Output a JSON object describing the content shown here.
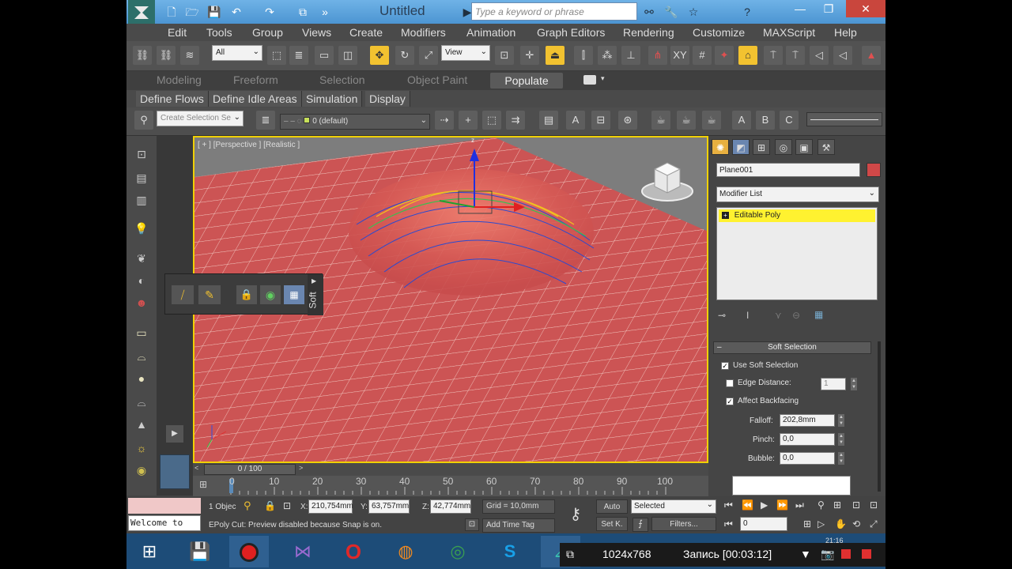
{
  "window": {
    "title": "Untitled",
    "search_placeholder": "Type a keyword or phrase"
  },
  "menu": [
    "Edit",
    "Tools",
    "Group",
    "Views",
    "Create",
    "Modifiers",
    "Animation",
    "Graph Editors",
    "Rendering",
    "Customize",
    "MAXScript",
    "Help"
  ],
  "toolbar": {
    "selection_filter": "All",
    "ref_coord": "View"
  },
  "ribbon": {
    "tabs": [
      "Modeling",
      "Freeform",
      "Selection",
      "Object Paint",
      "Populate"
    ],
    "active_tab": "Populate",
    "subtabs": [
      "Define Flows",
      "Define Idle Areas",
      "Simulation",
      "Display"
    ]
  },
  "populate_toolbar": {
    "selection_set_placeholder": "Create Selection Se",
    "layer": "0 (default)"
  },
  "viewport": {
    "label": "[ + ] [Perspective ] [Realistic ]",
    "axis_z": "z"
  },
  "caddy": {
    "label": "Soft"
  },
  "command_panel": {
    "object_name": "Plane001",
    "object_color": "#d04848",
    "modifier_list": "Modifier List",
    "stack_item": "Editable Poly",
    "rollout_title": "Soft Selection",
    "use_soft_selection": {
      "label": "Use Soft Selection",
      "checked": true
    },
    "edge_distance": {
      "label": "Edge Distance:",
      "checked": false,
      "value": "1"
    },
    "affect_backfacing": {
      "label": "Affect Backfacing",
      "checked": true
    },
    "falloff": {
      "label": "Falloff:",
      "value": "202,8mm"
    },
    "pinch": {
      "label": "Pinch:",
      "value": "0,0"
    },
    "bubble": {
      "label": "Bubble:",
      "value": "0,0"
    }
  },
  "timeline": {
    "slider_label": "0 / 100",
    "ticks": [
      "0",
      "10",
      "20",
      "30",
      "40",
      "50",
      "60",
      "70",
      "80",
      "90",
      "100"
    ]
  },
  "status": {
    "maxscript_listener": "Welcome to",
    "selection_count": "1 Objec",
    "x_value": "210,754mm",
    "y_value": "63,757mm",
    "z_value": "42,774mm",
    "grid": "Grid = 10,0mm",
    "prompt": "EPoly Cut: Preview disabled because Snap is on.",
    "add_time_tag": "Add Time Tag",
    "auto_key": "Auto",
    "set_key": "Set K.",
    "key_mode": "Selected",
    "filters": "Filters...",
    "frame": "0"
  },
  "recorder": {
    "resolution": "1024x768",
    "recording": "Запись [00:03:12]",
    "clock": "21:16"
  }
}
